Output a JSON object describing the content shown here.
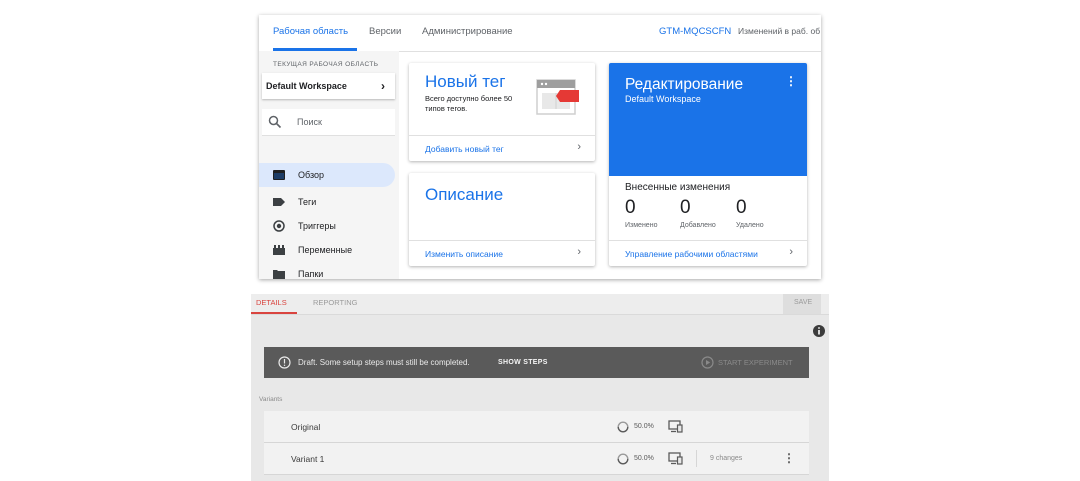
{
  "gtm": {
    "tabs": [
      {
        "label": "Рабочая область"
      },
      {
        "label": "Версии"
      },
      {
        "label": "Администрирование"
      }
    ],
    "container_id": "GTM-MQCSCFN",
    "workspace_changes": "Изменений в раб. об",
    "sidebar": {
      "workspace_caption": "ТЕКУЩАЯ РАБОЧАЯ ОБЛАСТЬ",
      "workspace_name": "Default Workspace",
      "search_placeholder": "Поиск",
      "items": [
        {
          "label": "Обзор",
          "icon": "folder-open-icon"
        },
        {
          "label": "Теги",
          "icon": "tag-icon"
        },
        {
          "label": "Триггеры",
          "icon": "trigger-icon"
        },
        {
          "label": "Переменные",
          "icon": "variables-icon"
        },
        {
          "label": "Папки",
          "icon": "folder-icon"
        }
      ]
    },
    "new_tag_card": {
      "title": "Новый тег",
      "subtitle": "Всего доступно более 50 типов тегов.",
      "link": "Добавить новый тег"
    },
    "description_card": {
      "title": "Описание",
      "link": "Изменить описание"
    },
    "edit_card": {
      "title": "Редактирование",
      "workspace": "Default Workspace",
      "changes_title": "Внесенные изменения",
      "stats": [
        {
          "value": "0",
          "label": "Изменено"
        },
        {
          "value": "0",
          "label": "Добавлено"
        },
        {
          "value": "0",
          "label": "Удалено"
        }
      ],
      "link": "Управление рабочими областями"
    },
    "colors": {
      "accent": "#1a73e8",
      "active_nav_bg": "#dce8fc",
      "tag_image_red": "#e53935"
    }
  },
  "optimize": {
    "tabs": [
      {
        "label": "DETAILS"
      },
      {
        "label": "REPORTING"
      }
    ],
    "save_label": "SAVE",
    "draft_message": "Draft.  Some setup steps must still be completed.",
    "show_steps": "SHOW STEPS",
    "start_experiment": "START EXPERIMENT",
    "variants_caption": "Variants",
    "variants": [
      {
        "name": "Original",
        "weight": "50.0%",
        "changes": ""
      },
      {
        "name": "Variant 1",
        "weight": "50.0%",
        "changes": "9 changes"
      }
    ],
    "colors": {
      "active_tab": "#d9443f",
      "draft_bar": "#5a5a5a"
    }
  }
}
